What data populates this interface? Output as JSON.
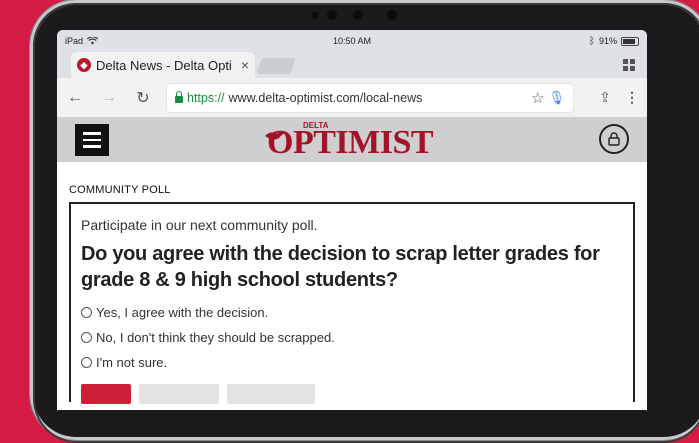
{
  "status_bar": {
    "device": "iPad",
    "time": "10:50 AM",
    "battery": "91%",
    "icons": [
      "wifi-icon",
      "bluetooth-icon",
      "battery-icon"
    ]
  },
  "browser": {
    "tab_title": "Delta News - Delta Opti",
    "tab_close": "×",
    "url_scheme": "https://",
    "url_host": "www.delta-optimist.com/local-news"
  },
  "site": {
    "logo_small": "DELTA",
    "logo_main": "OPTIMIST",
    "brand_color": "#a3122b"
  },
  "poll": {
    "section_label": "COMMUNITY POLL",
    "intro": "Participate in our next community poll.",
    "question": "Do you agree with the decision to scrap letter grades for grade 8 & 9 high school students?",
    "options": [
      "Yes, I agree with the decision.",
      "No, I don't think they should be scrapped.",
      "I'm not sure."
    ],
    "vote_color": "#cf1f36"
  },
  "colors": {
    "background": "#d41b45",
    "device": "#1b1b1d"
  }
}
